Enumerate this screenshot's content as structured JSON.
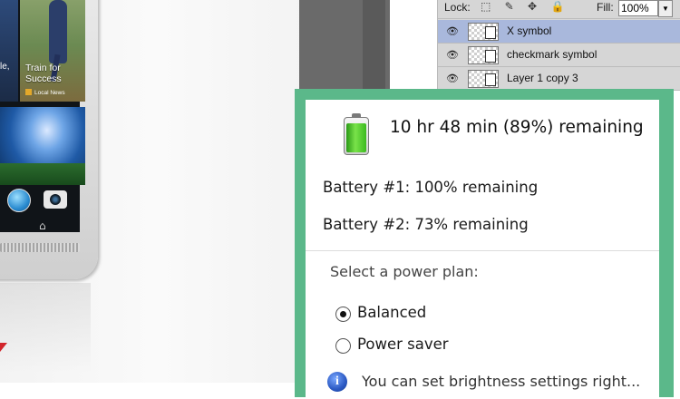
{
  "phone": {
    "tile_left_text": "le,",
    "tile_title": "Train for Success",
    "tile_source": "Local News",
    "home_glyph": "⌂"
  },
  "layers_panel": {
    "lock_label": "Lock:",
    "lock_icons": "⬚ ✎ ✥ 🔒",
    "fill_label": "Fill:",
    "fill_value": "100%",
    "fill_dropdown": "▼",
    "layers": [
      {
        "name": "X symbol",
        "selected": true,
        "eye": "👁"
      },
      {
        "name": "checkmark symbol",
        "selected": false,
        "eye": "👁"
      },
      {
        "name": "Layer 1 copy 3",
        "selected": false,
        "eye": "👁"
      }
    ]
  },
  "battery_flyout": {
    "summary": "10 hr 48 min (89%) remaining",
    "charge_percent": 89,
    "battery1": "Battery #1: 100% remaining",
    "battery2": "Battery #2: 73% remaining",
    "plan_title": "Select a power plan:",
    "plans": [
      {
        "label": "Balanced",
        "selected": true
      },
      {
        "label": "Power saver",
        "selected": false
      }
    ],
    "info_glyph": "i",
    "info_text": "You can set brightness settings right..."
  },
  "colors": {
    "flyout_border": "#5bb88a",
    "selected_layer": "#a9b8dc"
  }
}
